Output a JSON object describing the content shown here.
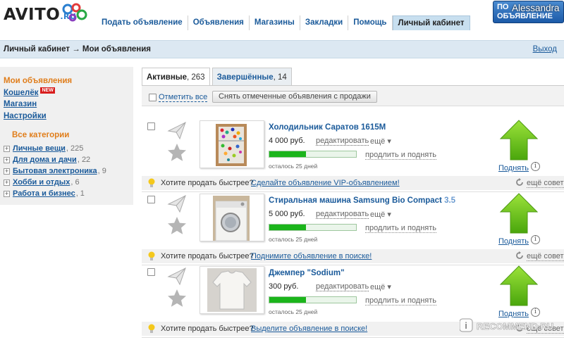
{
  "logo": {
    "brand": "AVITO",
    "tld": ".RU"
  },
  "nav": {
    "items": [
      "Подать объявление",
      "Объявления",
      "Магазины",
      "Закладки",
      "Помощь",
      "Личный кабинет"
    ]
  },
  "post_button": {
    "line1": "ПО",
    "line2": "ОБЪЯВЛЕНИЕ"
  },
  "user": {
    "name": "Alessandra"
  },
  "breadcrumb": {
    "text": "Личный кабинет → Мои объявления",
    "logout": "Выход"
  },
  "sidebar": {
    "my_ads": "Мои объявления",
    "wallet": "Кошелёк",
    "wallet_badge": "NEW",
    "shop": "Магазин",
    "settings": "Настройки",
    "categories_title": "Все категории",
    "categories": [
      {
        "label": "Личные вещи",
        "count": ", 225"
      },
      {
        "label": "Для дома и дачи",
        "count": ", 22"
      },
      {
        "label": "Бытовая электроника",
        "count": ", 9"
      },
      {
        "label": "Хобби и отдых",
        "count": ", 6"
      },
      {
        "label": "Работа и бизнес",
        "count": ", 1"
      }
    ]
  },
  "tabs": [
    {
      "label": "Активные",
      "count": ", 263"
    },
    {
      "label": "Завершённые",
      "count": ", 14"
    }
  ],
  "toolbar": {
    "mark_all": "Отметить все",
    "unpublish": "Снять отмеченные объявления с продажи"
  },
  "ads": [
    {
      "title": "Холодильник Саратов 1615М",
      "title_extra": "",
      "price": "4 000 руб.",
      "edit": "редактировать",
      "more": "ещё ▾",
      "raise_link": "продлить и поднять",
      "progress": 0.42,
      "days_left": "осталось 25 дней",
      "raise_button": "Поднять",
      "tip_text": "Хотите продать быстрее?",
      "tip_link": "Сделайте объявление VIP-объявлением!",
      "more_tips": "ещё совет",
      "photo_icon": "fridge-photo"
    },
    {
      "title": "Стиральная машина Samsung Bio Compact",
      "title_extra": "3.5",
      "price": "5 000 руб.",
      "edit": "редактировать",
      "more": "ещё ▾",
      "raise_link": "продлить и поднять",
      "progress": 0.42,
      "days_left": "осталось 25 дней",
      "raise_button": "Поднять",
      "tip_text": "Хотите продать быстрее?",
      "tip_link": "Поднимите объявление в поиске!",
      "more_tips": "ещё совет",
      "photo_icon": "washing-machine-photo"
    },
    {
      "title": "Джемпер \"Sodium\"",
      "title_extra": "",
      "price": "300 руб.",
      "edit": "редактировать",
      "more": "ещё ▾",
      "raise_link": "продлить и поднять",
      "progress": 0.42,
      "days_left": "осталось 25 дней",
      "raise_button": "Поднять",
      "tip_text": "Хотите продать быстрее?",
      "tip_link": "Выделите объявление в поиске!",
      "more_tips": "ещё совет",
      "photo_icon": "sweater-photo"
    }
  ],
  "watermark": {
    "text": "RECOMMEND.RU"
  },
  "colors": {
    "accent_orange": "#e07d1a",
    "link_blue": "#1a5a9a",
    "progress_green": "#1bb51b",
    "arrow_green": "#66c414"
  }
}
